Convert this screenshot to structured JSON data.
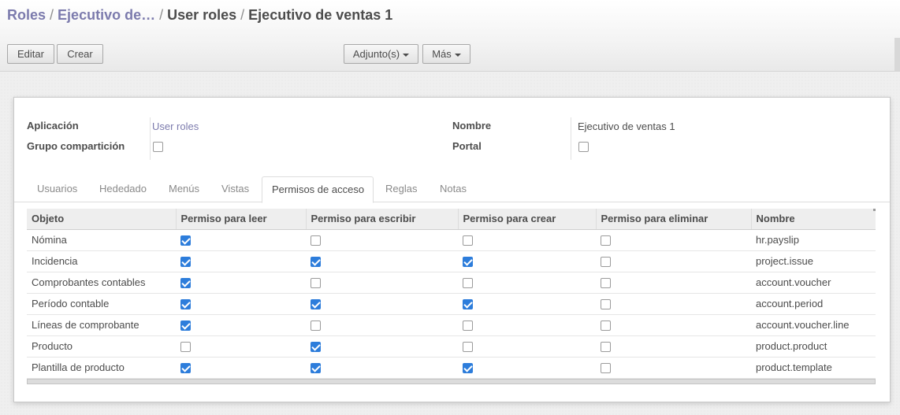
{
  "breadcrumb": {
    "items": [
      "Roles",
      "Ejecutivo de…",
      "User roles",
      "Ejecutivo de ventas 1"
    ],
    "separator": "/"
  },
  "toolbar": {
    "edit_label": "Editar",
    "create_label": "Crear",
    "attachments_label": "Adjunto(s)",
    "more_label": "Más"
  },
  "form": {
    "application_label": "Aplicación",
    "application_value": "User roles",
    "share_group_label": "Grupo compartición",
    "share_group_checked": false,
    "name_label": "Nombre",
    "name_value": "Ejecutivo de ventas 1",
    "portal_label": "Portal",
    "portal_checked": false
  },
  "tabs": [
    {
      "label": "Usuarios",
      "active": false
    },
    {
      "label": "Hededado",
      "active": false
    },
    {
      "label": "Menús",
      "active": false
    },
    {
      "label": "Vistas",
      "active": false
    },
    {
      "label": "Permisos de acceso",
      "active": true
    },
    {
      "label": "Reglas",
      "active": false
    },
    {
      "label": "Notas",
      "active": false
    }
  ],
  "access_table": {
    "columns": [
      "Objeto",
      "Permiso para leer",
      "Permiso para escribir",
      "Permiso para crear",
      "Permiso para eliminar",
      "Nombre"
    ],
    "rows": [
      {
        "object": "Nómina",
        "read": true,
        "write": false,
        "create": false,
        "unlink": false,
        "name": "hr.payslip"
      },
      {
        "object": "Incidencia",
        "read": true,
        "write": true,
        "create": true,
        "unlink": false,
        "name": "project.issue"
      },
      {
        "object": "Comprobantes contables",
        "read": true,
        "write": false,
        "create": false,
        "unlink": false,
        "name": "account.voucher"
      },
      {
        "object": "Período contable",
        "read": true,
        "write": true,
        "create": true,
        "unlink": false,
        "name": "account.period"
      },
      {
        "object": "Líneas de comprobante",
        "read": true,
        "write": false,
        "create": false,
        "unlink": false,
        "name": "account.voucher.line"
      },
      {
        "object": "Producto",
        "read": false,
        "write": true,
        "create": false,
        "unlink": false,
        "name": "product.product"
      },
      {
        "object": "Plantilla de producto",
        "read": true,
        "write": true,
        "create": true,
        "unlink": false,
        "name": "product.template"
      }
    ]
  },
  "colors": {
    "link": "#7c7bad",
    "checkbox_on": "#2d7ddb",
    "text": "#4c4c4c"
  }
}
